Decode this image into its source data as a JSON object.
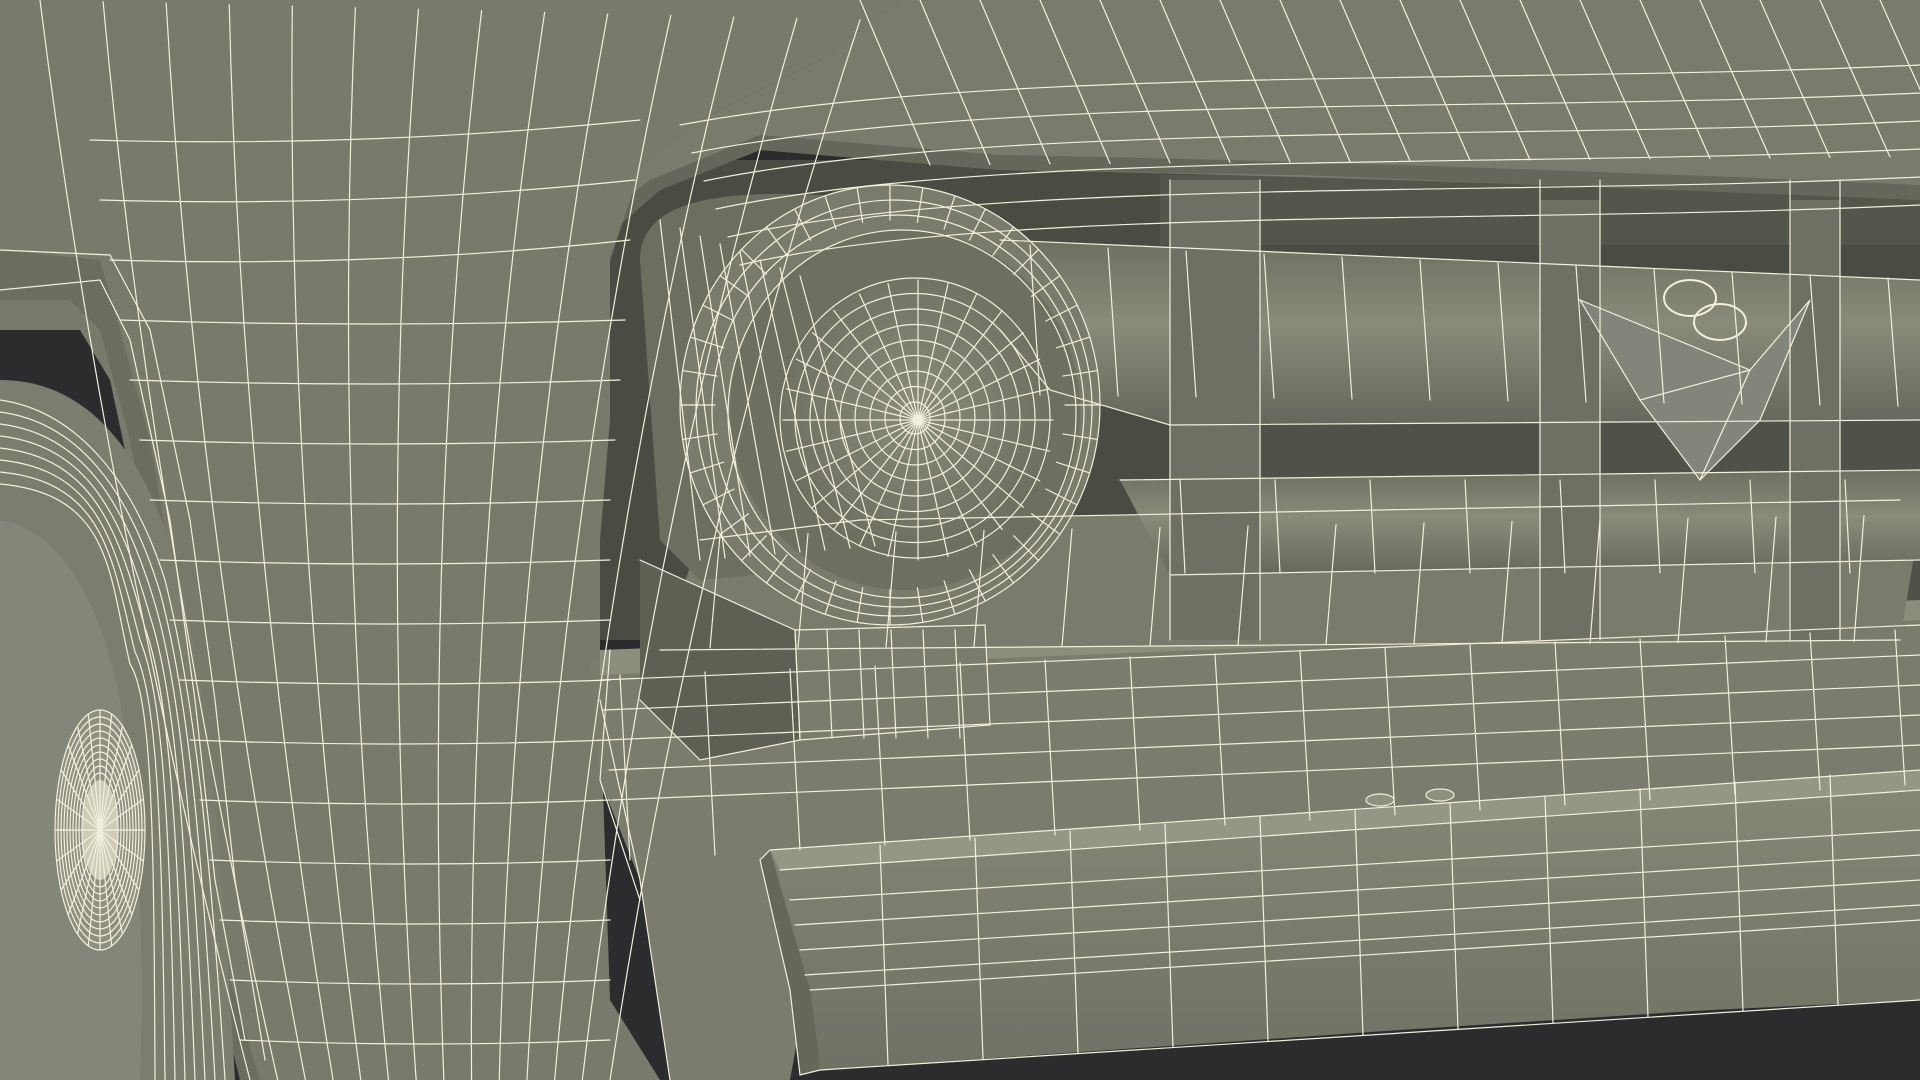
{
  "scene": {
    "subject": "wireframe-render-truck-front",
    "colors": {
      "backdrop": "#2c2c2e",
      "surface": "#7a7b6c",
      "surface_dark": "#5f6054",
      "surface_shadow": "#4a4b42",
      "surface_light": "#8b8c7c",
      "wire": "#f2efdd"
    }
  }
}
